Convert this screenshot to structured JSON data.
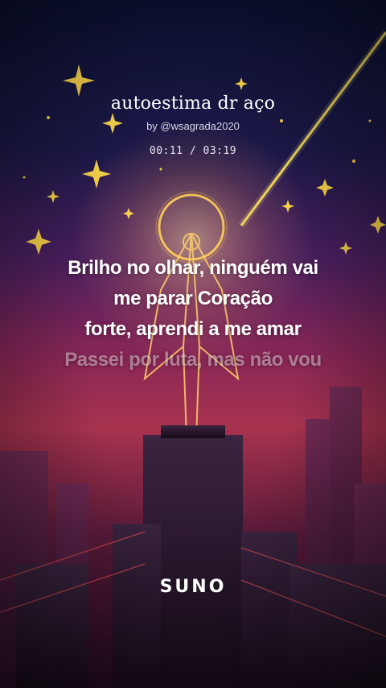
{
  "song": {
    "title": "autoestima dr aço",
    "artist": "by @wsagrada2020"
  },
  "player": {
    "time": "00:11 / 03:19"
  },
  "lyrics": {
    "lines": [
      "Brilho no olhar, ninguém vai",
      "me parar Coração",
      "forte, aprendi a me amar",
      "Passei por luta, mas não vou"
    ]
  },
  "brand": {
    "logo_text": "SUNO"
  },
  "colors": {
    "sky_top": "#0b1030",
    "sky_mid": "#8a2756",
    "star": "#ffd84a",
    "beam": "#ffe04a"
  },
  "icons": {
    "background": "cover-art-illustration"
  }
}
